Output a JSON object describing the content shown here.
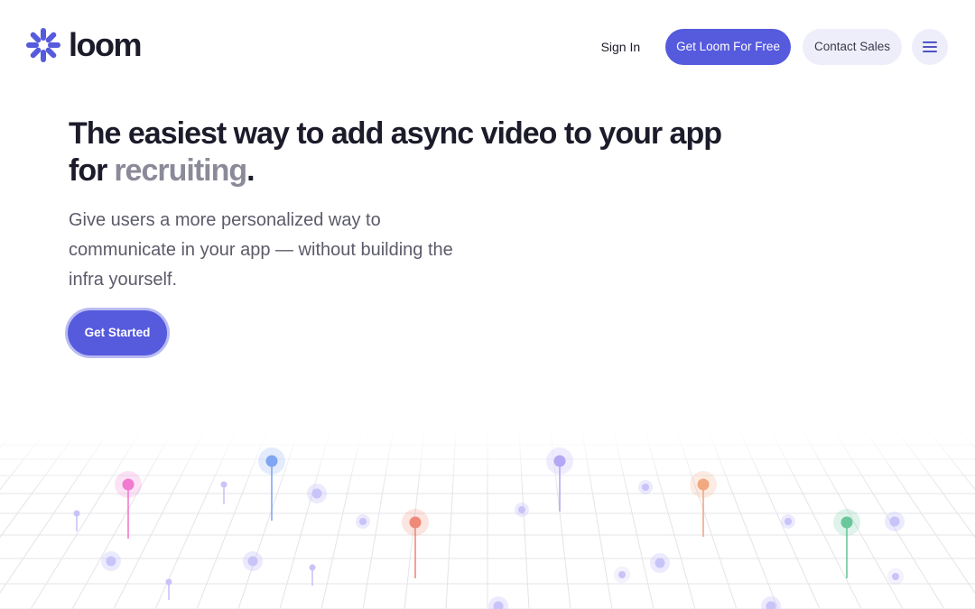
{
  "brand": {
    "name": "loom",
    "color": "#565ADD"
  },
  "nav": {
    "sign_in": "Sign In",
    "get_free": "Get Loom For Free",
    "contact_sales": "Contact Sales",
    "menu_icon": "hamburger-menu-icon"
  },
  "hero": {
    "headline_line1": "The easiest way to add async video to your app",
    "headline_for": "for",
    "headline_accent": "recruiting",
    "headline_period": ".",
    "subtext": "Give users a more personalized way to communicate in your app — without building the infra yourself.",
    "cta": "Get Started"
  },
  "colors": {
    "accent": "#565ADD",
    "accent_soft": "#EEEEFB",
    "pin_pink": "#F07BD0",
    "pin_blue": "#7FA6F3",
    "pin_purple": "#B6A7F4",
    "pin_red": "#EF8A78",
    "pin_orange": "#F2A880",
    "pin_green": "#69C79B",
    "dot_lavender": "#C8C3F8"
  }
}
